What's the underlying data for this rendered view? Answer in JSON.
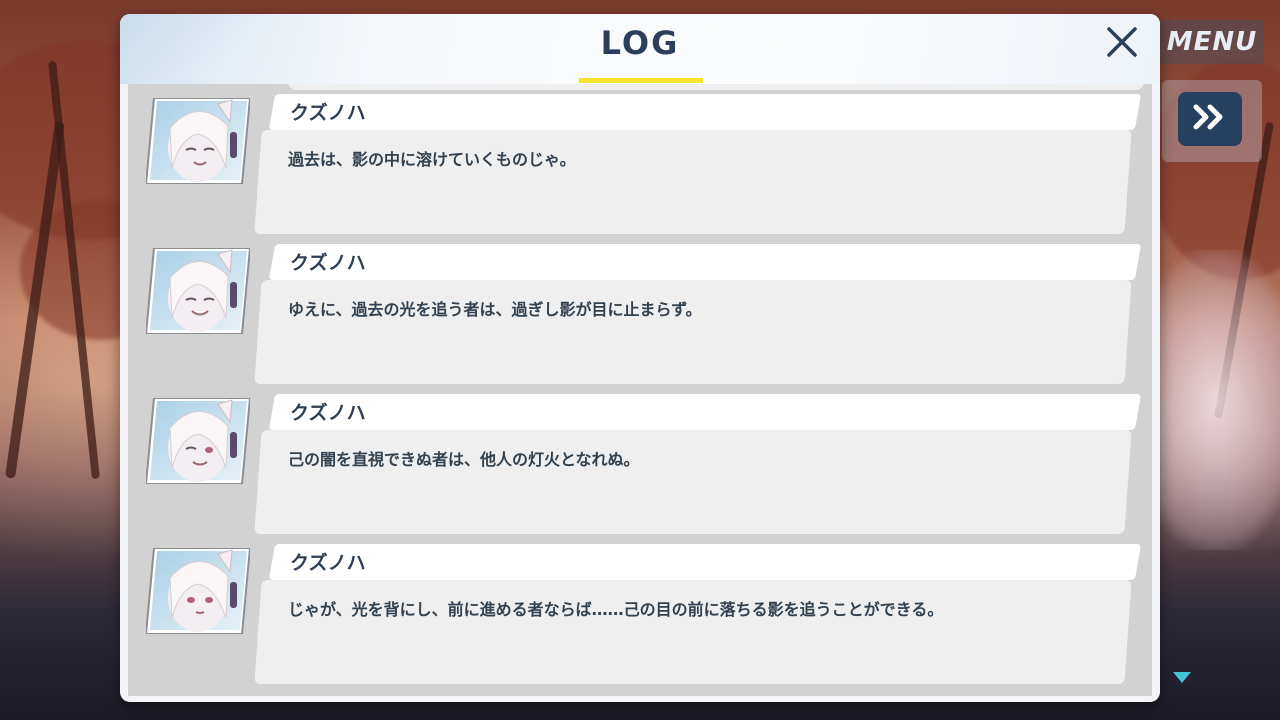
{
  "menu_label": "MENU",
  "log_title": "LOG",
  "icons": {
    "close": "close-icon",
    "fast_forward": "fast-forward-icon",
    "scroll_down": "triangle-down-icon",
    "portrait": "character-portrait"
  },
  "colors": {
    "title": "#2b3f5c",
    "underline": "#f7e22f",
    "ffwd_button": "#26405f",
    "scroll_indicator": "#43c3d6"
  },
  "entries": [
    {
      "speaker": "クズノハ",
      "text": "過去は、影の中に溶けていくものじゃ。"
    },
    {
      "speaker": "クズノハ",
      "text": "ゆえに、過去の光を追う者は、過ぎし影が目に止まらず。"
    },
    {
      "speaker": "クズノハ",
      "text": "己の闇を直視できぬ者は、他人の灯火となれぬ。"
    },
    {
      "speaker": "クズノハ",
      "text": "じゃが、光を背にし、前に進める者ならば……己の目の前に落ちる影を追うことができる。"
    }
  ]
}
